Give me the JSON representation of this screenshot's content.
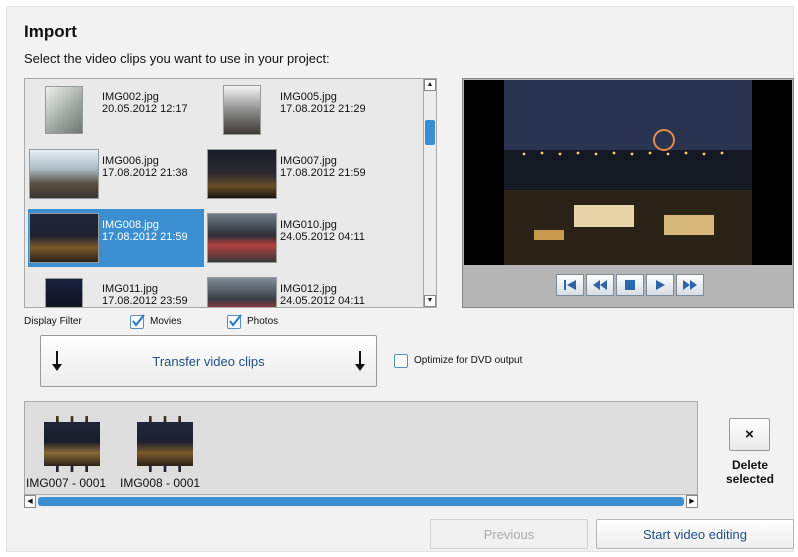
{
  "header": {
    "title": "Import",
    "subtitle": "Select the video clips you want to use in your project:"
  },
  "browser": {
    "items": [
      {
        "name": "IMG002.jpg",
        "date": "20.05.2012 12:17"
      },
      {
        "name": "IMG005.jpg",
        "date": "17.08.2012 21:29"
      },
      {
        "name": "IMG006.jpg",
        "date": "17.08.2012 21:38"
      },
      {
        "name": "IMG007.jpg",
        "date": "17.08.2012 21:59"
      },
      {
        "name": "IMG008.jpg",
        "date": "17.08.2012 21:59",
        "selected": true
      },
      {
        "name": "IMG010.jpg",
        "date": "24.05.2012 04:11"
      },
      {
        "name": "IMG011.jpg",
        "date": "17.08.2012 23:59"
      },
      {
        "name": "IMG012.jpg",
        "date": "24.05.2012 04:11"
      }
    ]
  },
  "filter": {
    "label": "Display Filter",
    "movies_label": "Movies",
    "movies_checked": true,
    "photos_label": "Photos",
    "photos_checked": true
  },
  "transfer": {
    "label": "Transfer video clips",
    "dvd_label": "Optimize for DVD output",
    "dvd_checked": false
  },
  "strip": {
    "clips": [
      {
        "label": "IMG007 - 0001"
      },
      {
        "label": "IMG008 - 0001"
      }
    ]
  },
  "delete": {
    "icon": "×",
    "label_line1": "Delete",
    "label_line2": "selected"
  },
  "footer": {
    "previous_label": "Previous",
    "start_label": "Start video editing"
  },
  "colors": {
    "selection": "#3b8fd1",
    "link_text": "#1f4f86"
  }
}
